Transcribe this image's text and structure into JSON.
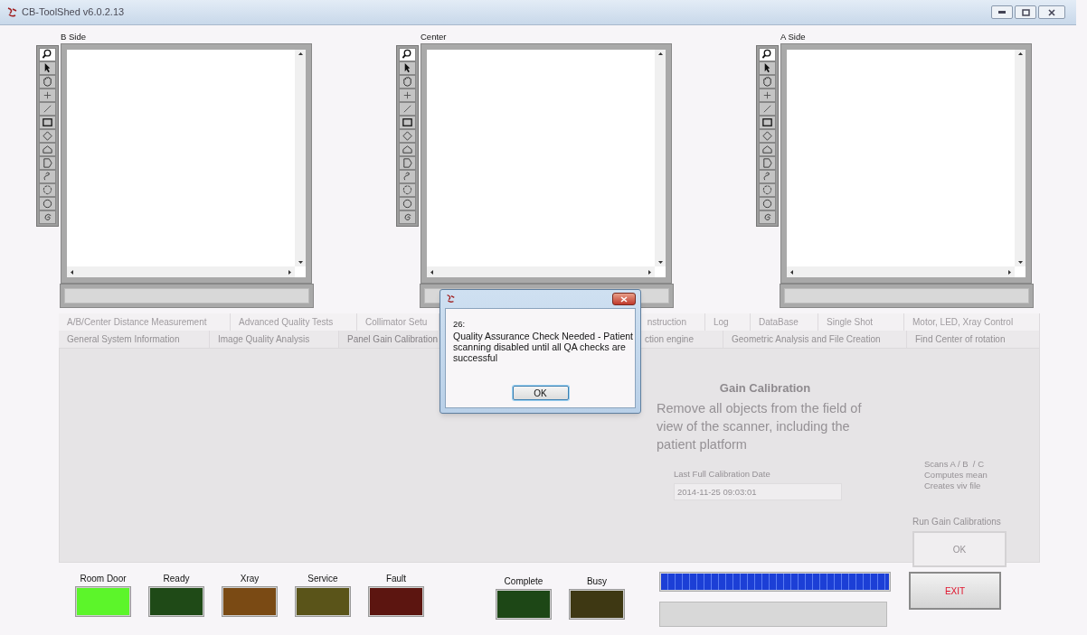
{
  "window": {
    "title": "CB-ToolShed v6.0.2.13"
  },
  "image_panels": [
    {
      "label": "B Side",
      "tools": [
        {
          "selected": true
        },
        {
          "selected": false
        },
        {
          "selected": false
        },
        {
          "selected": false
        },
        {
          "selected": false
        },
        {
          "selected": false
        },
        {
          "selected": false
        },
        {
          "selected": false
        },
        {
          "selected": false
        },
        {
          "selected": false
        },
        {
          "selected": false
        },
        {
          "selected": false
        },
        {
          "selected": false
        }
      ]
    },
    {
      "label": "Center",
      "tools": [
        {
          "selected": true
        },
        {
          "selected": false
        },
        {
          "selected": false
        },
        {
          "selected": false
        },
        {
          "selected": false
        },
        {
          "selected": false
        },
        {
          "selected": false
        },
        {
          "selected": false
        },
        {
          "selected": false
        },
        {
          "selected": false
        },
        {
          "selected": false
        },
        {
          "selected": false
        },
        {
          "selected": false
        }
      ]
    },
    {
      "label": "A Side",
      "tools": [
        {
          "selected": true
        },
        {
          "selected": false
        },
        {
          "selected": false
        },
        {
          "selected": false
        },
        {
          "selected": false
        },
        {
          "selected": false
        },
        {
          "selected": false
        },
        {
          "selected": false
        },
        {
          "selected": false
        },
        {
          "selected": false
        },
        {
          "selected": false
        },
        {
          "selected": false
        },
        {
          "selected": false
        }
      ]
    }
  ],
  "tab_rows": [
    {
      "tabs": [
        {
          "label": "A/B/Center Distance Measurement",
          "selected": false
        },
        {
          "label": "Advanced Quality Tests",
          "selected": false
        },
        {
          "label": "Collimator Setu",
          "selected": false
        },
        {
          "label": "nstruction",
          "selected": false
        },
        {
          "label": "Log",
          "selected": false
        },
        {
          "label": "DataBase",
          "selected": false
        },
        {
          "label": "Single Shot",
          "selected": false
        },
        {
          "label": "Motor, LED, Xray Control",
          "selected": false
        }
      ]
    },
    {
      "tabs": [
        {
          "label": "General System Information",
          "selected": false
        },
        {
          "label": "Image Quality Analysis",
          "selected": false
        },
        {
          "label": "Panel Gain Calibration",
          "selected": true
        },
        {
          "label": "ction engine",
          "selected": false
        },
        {
          "label": "Geometric Analysis and File Creation",
          "selected": false
        },
        {
          "label": "Find Center of rotation",
          "selected": false
        }
      ]
    }
  ],
  "gain_calibration": {
    "disabled": true,
    "title": "Gain Calibration",
    "instructions": "Remove all objects from the field of view of the scanner, including the patient platform",
    "date_label": "Last Full Calibration Date",
    "date_value": "2014-11-25 09:03:01",
    "notes": [
      "Scans A / B  / C",
      "Computes mean",
      "Creates viv file"
    ],
    "run_label": "Run Gain Calibrations",
    "run_button": "OK"
  },
  "indicators": [
    {
      "label": "Room Door",
      "color": "#5cf52a"
    },
    {
      "label": "Ready",
      "color": "#1f4a17"
    },
    {
      "label": "Xray",
      "color": "#7a4a14"
    },
    {
      "label": "Service",
      "color": "#5a5419"
    },
    {
      "label": "Fault",
      "color": "#5c1510"
    }
  ],
  "status_indicators": [
    {
      "label": "Complete",
      "color": "#1d4716"
    },
    {
      "label": "Busy",
      "color": "#3e3813"
    }
  ],
  "progress": {
    "level": 1
  },
  "exit_button": "EXIT",
  "dialog": {
    "code": "26:",
    "message": "Quality Assurance Check Needed - Patient scanning disabled until all QA checks are successful",
    "ok": "OK"
  }
}
